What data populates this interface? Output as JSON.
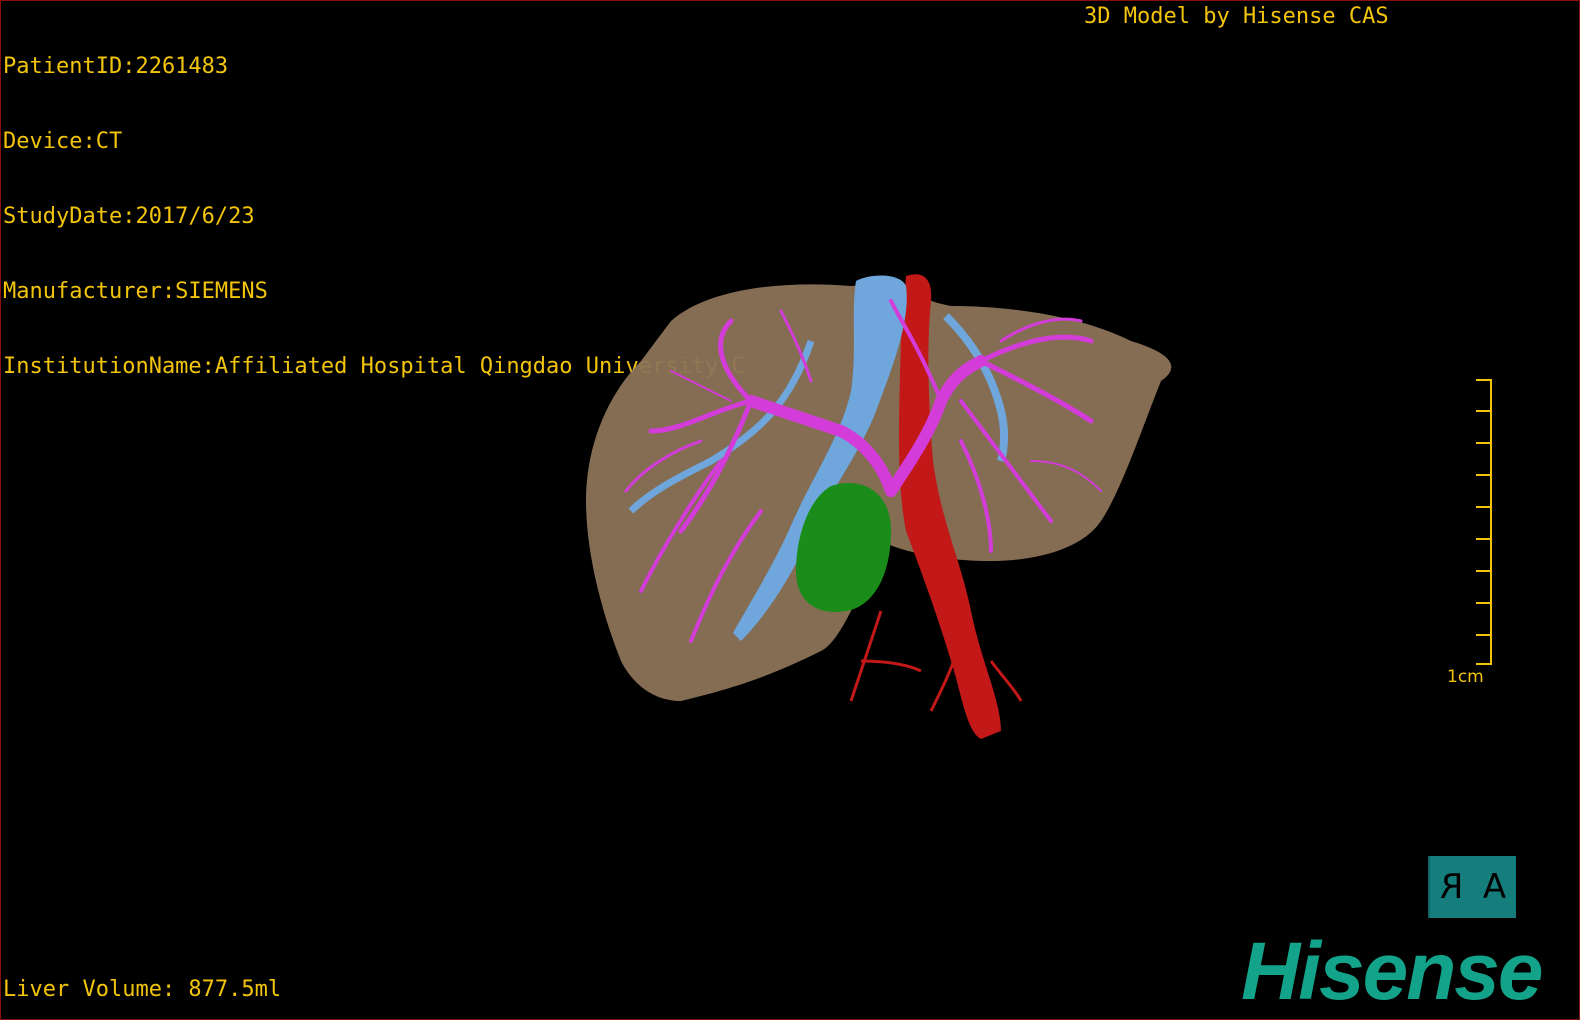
{
  "patient_info": {
    "patient_id": "PatientID:2261483",
    "device": "Device:CT",
    "study_date": "StudyDate:2017/6/23",
    "manufacturer": "Manufacturer:SIEMENS",
    "institution": "InstitutionName:Affiliated Hospital Qingdao University-C"
  },
  "credit": "3D Model by Hisense CAS",
  "liver_volume": "Liver Volume: 877.5ml",
  "scale_bar": {
    "label": "1cm"
  },
  "orientation": {
    "left": "R",
    "right": "A"
  },
  "brand_logo": "Hisense",
  "colors": {
    "overlay_text": "#f2c40c",
    "liver": "#8b7357",
    "portal_vein": "#d33cd8",
    "hepatic_vein": "#6fa6dc",
    "artery": "#c21818",
    "gallbladder": "#1a8c1a",
    "logo": "#12a38a",
    "orientation_box": "#167d7d"
  }
}
